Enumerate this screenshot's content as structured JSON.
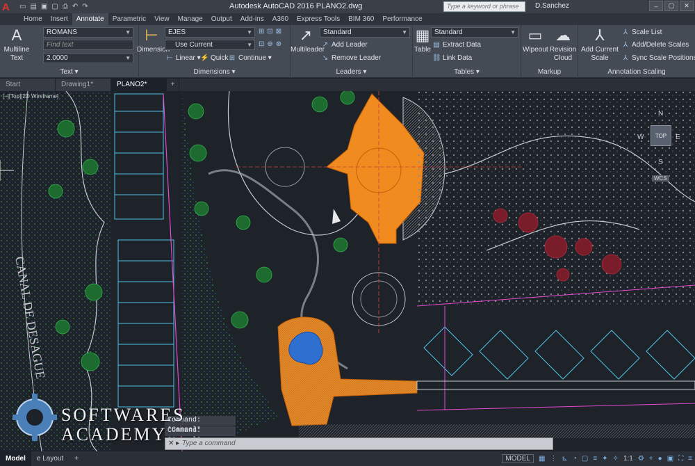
{
  "app": {
    "title": "Autodesk AutoCAD 2016   PLANO2.dwg",
    "search_placeholder": "Type a keyword or phrase",
    "user": "D.Sanchez"
  },
  "ribbon_tabs": [
    "Home",
    "Insert",
    "Annotate",
    "Parametric",
    "View",
    "Manage",
    "Output",
    "Add-ins",
    "A360",
    "Express Tools",
    "BIM 360",
    "Performance"
  ],
  "active_ribbon_tab": "Annotate",
  "text_panel": {
    "title": "Text",
    "multiline_text": "Multiline Text",
    "style": "ROMANS",
    "find_placeholder": "Find text",
    "height": "2.0000"
  },
  "dimensions_panel": {
    "title": "Dimensions",
    "dimension": "Dimension",
    "style": "EJES",
    "layer": "Use Current",
    "linear": "Linear",
    "quick": "Quick",
    "continue": "Continue"
  },
  "leaders_panel": {
    "title": "Leaders",
    "multileader": "Multileader",
    "style": "Standard",
    "add_leader": "Add Leader",
    "remove_leader": "Remove Leader"
  },
  "tables_panel": {
    "title": "Tables",
    "table": "Table",
    "style": "Standard",
    "extract_data": "Extract Data",
    "link_data": "Link Data"
  },
  "markup_panel": {
    "title": "Markup",
    "wipeout": "Wipeout",
    "revision_cloud": "Revision Cloud"
  },
  "scaling_panel": {
    "title": "Annotation Scaling",
    "add_current_scale": "Add Current Scale",
    "scale_list": "Scale List",
    "add_delete_scales": "Add/Delete Scales",
    "sync_scale_positions": "Sync Scale Positions"
  },
  "doc_tabs": [
    "Start",
    "Drawing1*",
    "PLANO2*"
  ],
  "active_doc": "PLANO2*",
  "viewport_label": "[–][Top][2D Wireframe]",
  "viewcube": {
    "face": "TOP",
    "n": "N",
    "s": "S",
    "w": "W",
    "e": "E",
    "wcs": "WCS"
  },
  "drawing_text": "CANAL DE DESAGUE",
  "command_history": [
    "Command: *Cancel*",
    "Command: *Cancel*"
  ],
  "command_placeholder": "Type a command",
  "watermark": {
    "line1": "SOFTWARES",
    "line2": "ACADEMY"
  },
  "status": {
    "model_tab": "Model",
    "layout_tab": "e Layout",
    "model_btn": "MODEL",
    "scale": "1:1"
  },
  "colors": {
    "accent": "#f28a1c",
    "plaza_orange": "#ef8b1f",
    "trees_green": "#2aa34a",
    "canvas": "#1e2229"
  }
}
